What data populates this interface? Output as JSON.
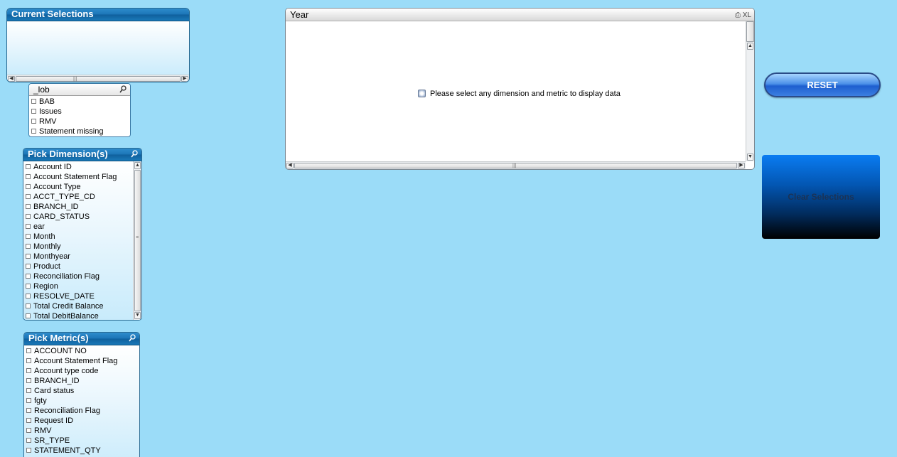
{
  "current_selections": {
    "title": "Current Selections"
  },
  "lob": {
    "title": "_lob",
    "items": [
      "BAB",
      "Issues",
      "RMV",
      "Statement missing"
    ]
  },
  "pick_dimensions": {
    "title": "Pick Dimension(s)",
    "items": [
      "Account ID",
      "Account Statement Flag",
      "Account Type",
      "ACCT_TYPE_CD",
      "BRANCH_ID",
      "CARD_STATUS",
      "ear",
      "Month",
      "Monthly",
      "Monthyear",
      "Product",
      "Reconciliation Flag",
      "Region",
      "RESOLVE_DATE",
      "Total Credit Balance",
      "Total DebitBalance"
    ]
  },
  "pick_metrics": {
    "title": "Pick Metric(s)",
    "items": [
      "ACCOUNT NO",
      "Account Statement Flag",
      "Account type code",
      "BRANCH_ID",
      "Card status",
      "fgty",
      "Reconciliation Flag",
      "Request ID",
      "RMV",
      "SR_TYPE",
      "STATEMENT_QTY"
    ]
  },
  "year_chart": {
    "title": "Year",
    "tools_label": "XL",
    "message": "Please select any dimension and metric to display data"
  },
  "reset_button": {
    "label": "RESET"
  },
  "clear_button": {
    "label": "Clear Selections"
  },
  "colors": {
    "background": "#9bdcf8",
    "caption_blue": "#1b74b6",
    "reset_blue": "#1e5fcf"
  }
}
